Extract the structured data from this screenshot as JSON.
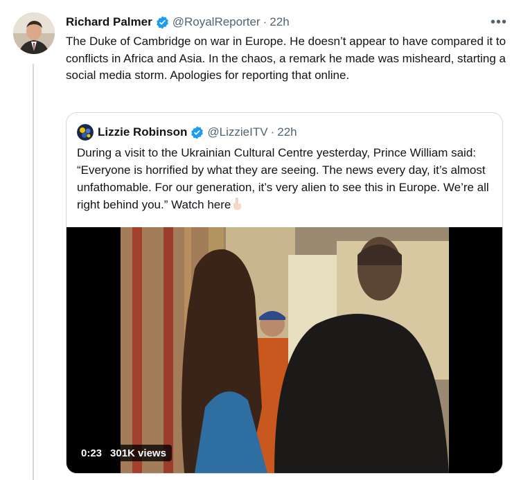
{
  "tweet": {
    "author_name": "Richard Palmer",
    "handle": "@RoyalReporter",
    "separator": "·",
    "time": "22h",
    "more_label": "•••",
    "text": "The Duke of Cambridge on war in Europe. He doesn’t appear to have compared it to conflicts in Africa and Asia. In the chaos, a remark he made was misheard, starting a social media storm. Apologies for reporting that online."
  },
  "quote": {
    "author_name": "Lizzie Robinson",
    "handle": "@LizzieITV",
    "separator": "·",
    "time": "22h",
    "text": "During a visit to the Ukrainian Cultural Centre yesterday, Prince William said: “Everyone is horrified by what they are seeing. The news every day, it’s almost unfathomable. For our generation, it’s very alien to see this in Europe. We’re all right behind you.” Watch here",
    "emoji": "pointing-down-emoji",
    "video": {
      "duration": "0:23",
      "views": "301K views"
    }
  },
  "colors": {
    "verified": "#1d9bf0",
    "text": "#0f1419",
    "secondary": "#536471",
    "border": "#cfd9de"
  },
  "icons": {
    "verified": "verified-badge-icon",
    "more": "more-icon"
  }
}
